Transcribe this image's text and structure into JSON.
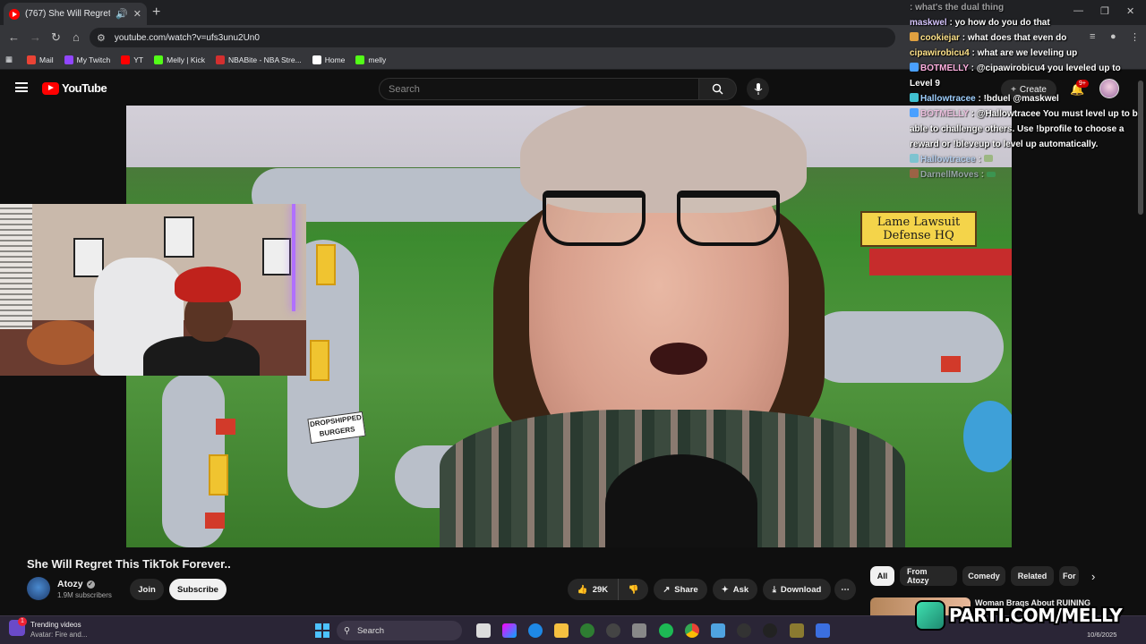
{
  "browser": {
    "tab_title": "(767) She Will Regret This T",
    "url": "youtube.com/watch?v=ufs3unu2Un0",
    "bookmarks": [
      {
        "label": "Mail",
        "color": "#ea4335"
      },
      {
        "label": "My Twitch",
        "color": "#9146ff"
      },
      {
        "label": "YT",
        "color": "#ff0000"
      },
      {
        "label": "Melly | Kick",
        "color": "#53fc18"
      },
      {
        "label": "NBABite - NBA Stre...",
        "color": "#d32f2f"
      },
      {
        "label": "Home",
        "color": "#ffffff"
      },
      {
        "label": "melly",
        "color": "#53fc18"
      }
    ]
  },
  "youtube": {
    "logo_text": "YouTube",
    "search_placeholder": "Search",
    "create_label": "Create",
    "notif_count": "9+"
  },
  "video": {
    "sign_text": "Lame Lawsuit Defense HQ",
    "burger_sign": "DROPSHIPPED BURGERS",
    "title": "She Will Regret This TikTok Forever..",
    "channel": "Atozy",
    "subscribers": "1.9M subscribers",
    "join": "Join",
    "subscribe": "Subscribe",
    "likes": "29K",
    "share": "Share",
    "ask": "Ask",
    "download": "Download"
  },
  "chips": [
    "All",
    "From Atozy",
    "Comedy",
    "Related",
    "For"
  ],
  "recommendation": {
    "title": "Woman Brags About RUINING"
  },
  "chat": [
    {
      "user": "",
      "text": "what's the dual thing",
      "style": "faded"
    },
    {
      "user": "maskwel",
      "text": "yo how do you do that",
      "style": ""
    },
    {
      "user": "cookiejar",
      "text": "what does that even do",
      "style": "y"
    },
    {
      "user": "cipawirobicu4",
      "text": "what are we leveling up",
      "style": "y"
    },
    {
      "user": "BOTMELLY",
      "text": "@cipawirobicu4 you leveled up to Level 9",
      "style": "bot",
      "wrap": true
    },
    {
      "user": "Hallowtracee",
      "text": "!bduel @maskwel",
      "style": "bot"
    },
    {
      "user": "BOTMELLY",
      "text": "@Hallowtracee You must level up to be able to challenge others. Use !bprofile to choose a reward or !bleveup to level up automatically.",
      "style": "bot faded-name",
      "wrap": true
    },
    {
      "user": "Hallowtracee",
      "text": "",
      "style": "faded"
    },
    {
      "user": "DarnellMoves",
      "text": "",
      "style": "faded"
    }
  ],
  "taskbar": {
    "trending_title": "Trending videos",
    "trending_sub": "Avatar: Fire and...",
    "search_label": "Search",
    "date": "10/6/2025"
  },
  "watermark": "PARTI.COM/MELLY",
  "colors": {
    "youtube_red": "#ff0000",
    "background": "#0f0f0f",
    "accent_parti": "#3fe0b0"
  }
}
